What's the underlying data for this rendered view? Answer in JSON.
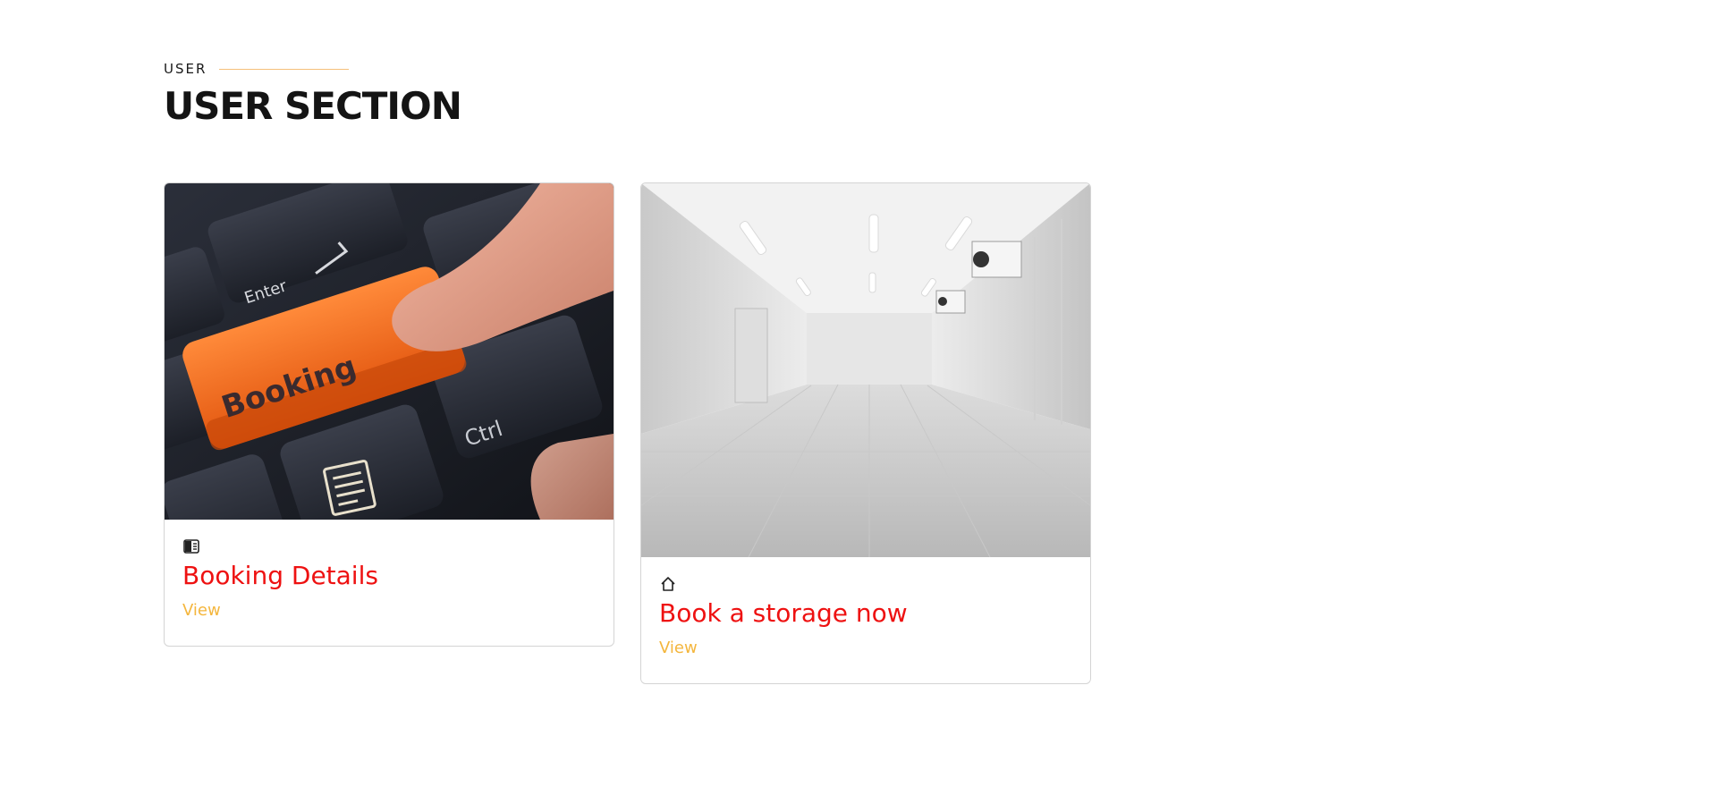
{
  "section": {
    "eyebrow": "USER",
    "title": "USER SECTION"
  },
  "cards": [
    {
      "title": "Booking Details",
      "link_label": "View",
      "icon": "columns-icon",
      "image": "booking-keyboard-photo",
      "image_text": {
        "key_main": "Booking",
        "key_enter": "Enter",
        "key_ctrl": "Ctrl"
      }
    },
    {
      "title": "Book a storage now",
      "link_label": "View",
      "icon": "home-icon",
      "image": "cold-storage-room-photo"
    }
  ],
  "colors": {
    "accent_red": "#ee1111",
    "link_gold": "#f4b63d",
    "eyebrow_line": "#f5c07a",
    "booking_key": "#f06414"
  }
}
